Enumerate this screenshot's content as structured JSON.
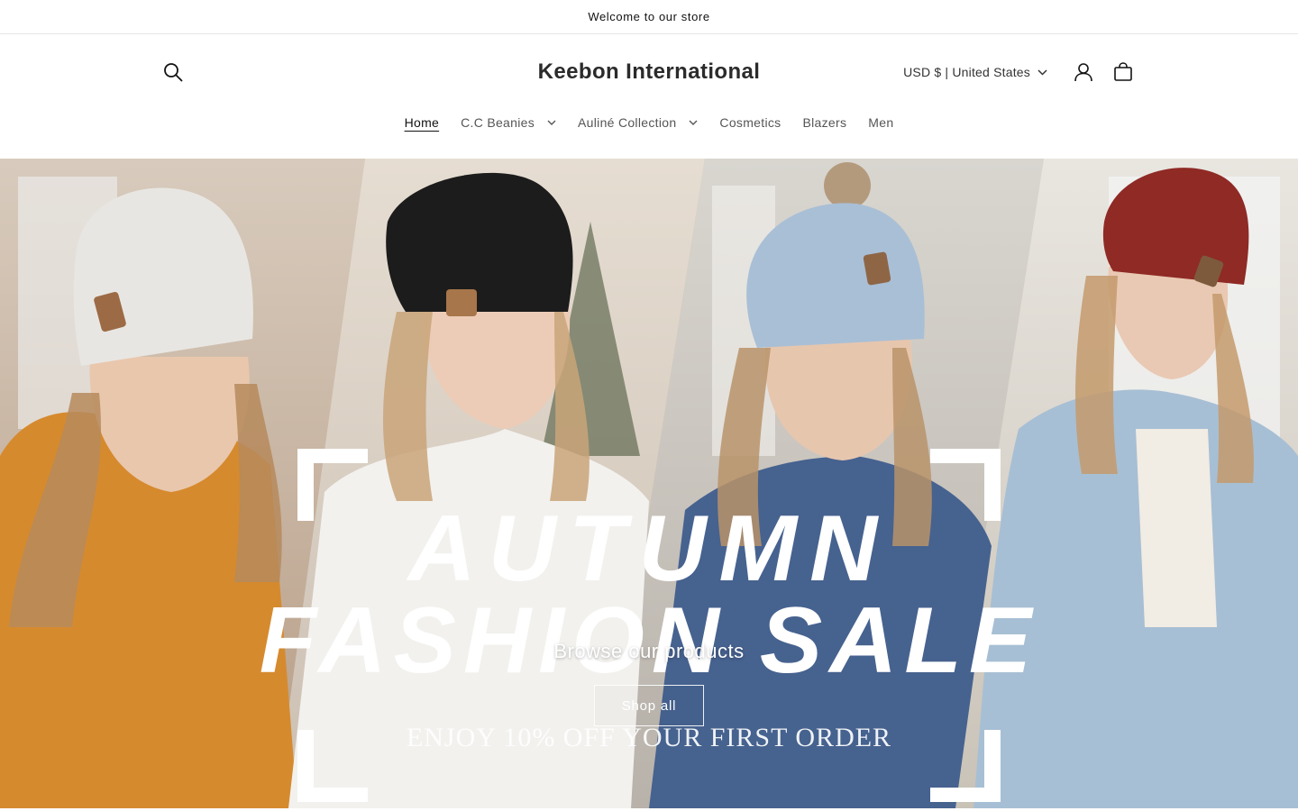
{
  "announcement": {
    "text": "Welcome to our store"
  },
  "header": {
    "store_name": "Keebon International",
    "search_icon": "search-icon",
    "currency_label": "USD $ | United States",
    "account_icon": "user-icon",
    "cart_icon": "cart-icon"
  },
  "nav": {
    "items": [
      {
        "label": "Home",
        "active": true,
        "has_dropdown": false
      },
      {
        "label": "C.C Beanies",
        "active": false,
        "has_dropdown": true
      },
      {
        "label": "Auliné Collection",
        "active": false,
        "has_dropdown": true
      },
      {
        "label": "Cosmetics",
        "active": false,
        "has_dropdown": false
      },
      {
        "label": "Blazers",
        "active": false,
        "has_dropdown": false
      },
      {
        "label": "Men",
        "active": false,
        "has_dropdown": false
      }
    ]
  },
  "hero": {
    "banner_line1": "AUTUMN",
    "banner_line2": "FASHION SALE",
    "banner_offer": "ENJOY 10% OFF YOUR FIRST ORDER",
    "subheading": "Browse our products",
    "button_label": "Shop all"
  },
  "colors": {
    "text": "#121212",
    "border": "#e6e6e6",
    "hero_text": "#ffffff"
  }
}
